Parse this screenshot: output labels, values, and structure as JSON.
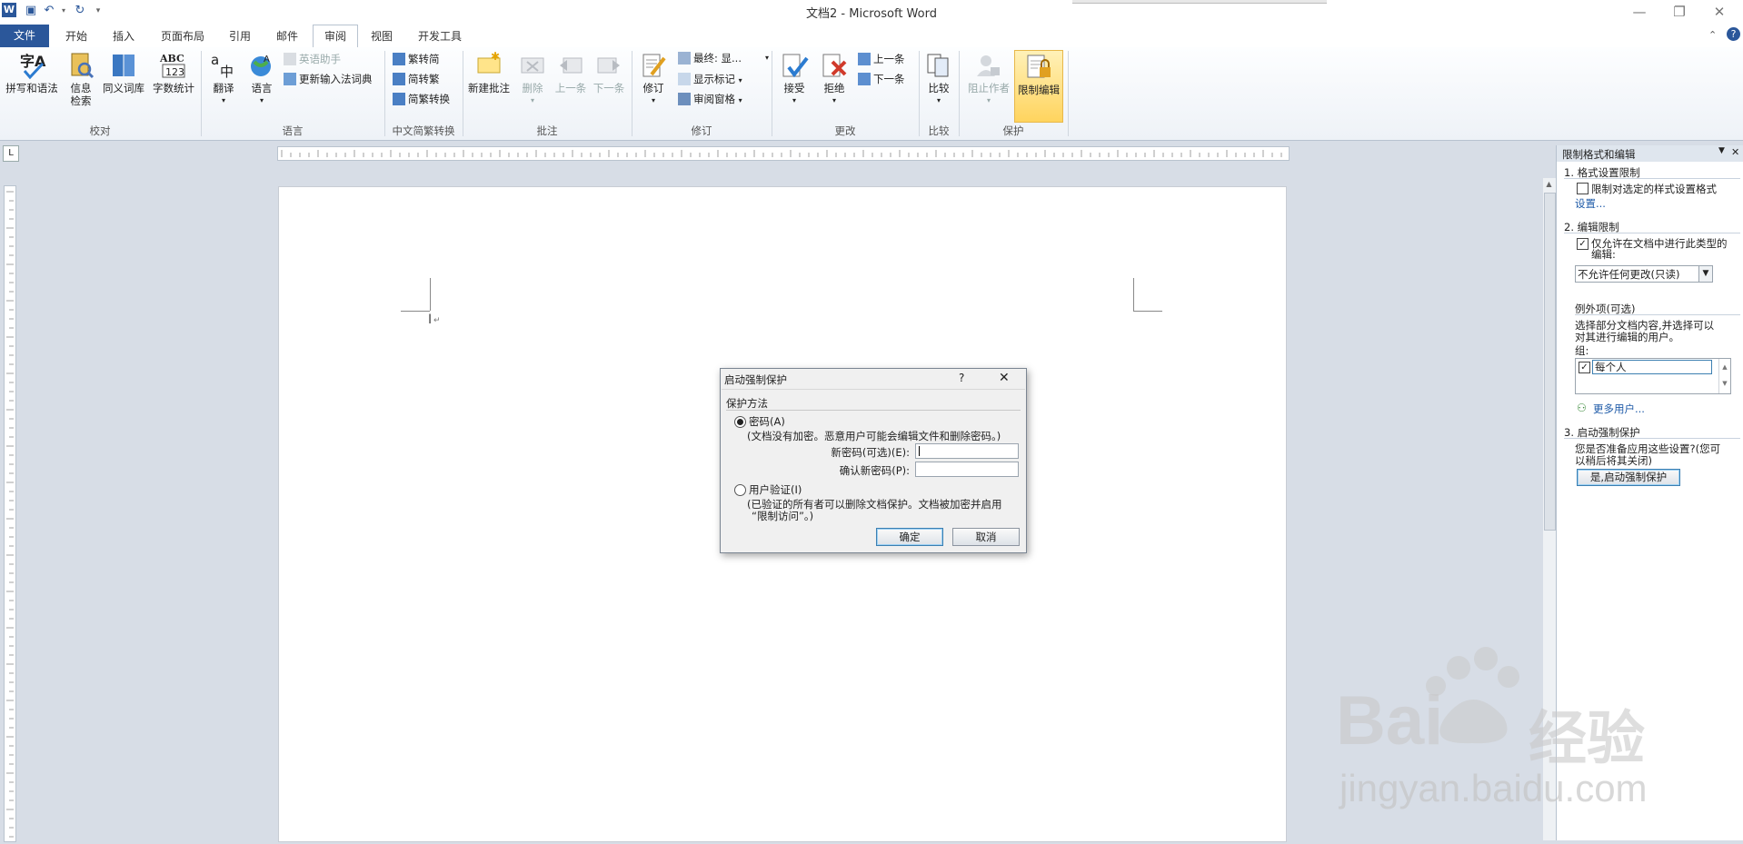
{
  "window": {
    "title": "文档2 - Microsoft Word"
  },
  "tabs": [
    {
      "label": "文件"
    },
    {
      "label": "开始"
    },
    {
      "label": "插入"
    },
    {
      "label": "页面布局"
    },
    {
      "label": "引用"
    },
    {
      "label": "邮件"
    },
    {
      "label": "审阅"
    },
    {
      "label": "视图"
    },
    {
      "label": "开发工具"
    }
  ],
  "ribbon": {
    "proofing": {
      "spell": "拼写和语法",
      "research1": "信息",
      "research2": "检索",
      "thesaurus": "同义词库",
      "wordcount": "字数统计",
      "group": "校对"
    },
    "language": {
      "translate": "翻译",
      "language": "语言",
      "english_assist": "英语助手",
      "update_ime": "更新输入法词典",
      "group": "语言"
    },
    "chinese": {
      "to_simplified": "繁转简",
      "to_traditional": "简转繁",
      "convert": "简繁转换",
      "group": "中文简繁转换"
    },
    "comments": {
      "new": "新建批注",
      "delete": "删除",
      "prev": "上一条",
      "next": "下一条",
      "group": "批注"
    },
    "tracking": {
      "track": "修订",
      "display": "最终: 显...",
      "show_markup": "显示标记",
      "pane": "审阅窗格",
      "group": "修订"
    },
    "changes": {
      "accept": "接受",
      "reject": "拒绝",
      "prev": "上一条",
      "next": "下一条",
      "group": "更改"
    },
    "compare": {
      "compare": "比较",
      "group": "比较"
    },
    "protect": {
      "block": "阻止作者",
      "restrict": "限制编辑",
      "group": "保护"
    }
  },
  "dialog": {
    "title": "启动强制保护",
    "help": "?",
    "close": "✕",
    "section": "保护方法",
    "password_option": "密码(A)",
    "password_note": "(文档没有加密。恶意用户可能会编辑文件和删除密码。)",
    "new_password_label": "新密码(可选)(E):",
    "confirm_password_label": "确认新密码(P):",
    "user_auth_option": "用户验证(I)",
    "user_auth_note1": "(已验证的所有者可以删除文档保护。文档被加密并启用",
    "user_auth_note2": "“限制访问”。)",
    "ok": "确定",
    "cancel": "取消"
  },
  "pane": {
    "title": "限制格式和编辑",
    "s1_title": "1. 格式设置限制",
    "s1_check": "限制对选定的样式设置格式",
    "s1_link": "设置...",
    "s2_title": "2. 编辑限制",
    "s2_check1": "仅允许在文档中进行此类型的",
    "s2_check2": "编辑:",
    "s2_select": "不允许任何更改(只读)",
    "exceptions_title": "例外项(可选)",
    "exceptions_desc1": "选择部分文档内容,并选择可以",
    "exceptions_desc2": "对其进行编辑的用户。",
    "group_label": "组:",
    "group_item": "每个人",
    "more_users": "更多用户...",
    "s3_title": "3. 启动强制保护",
    "s3_desc1": "您是否准备应用这些设置?(您可",
    "s3_desc2": "以稍后将其关闭)",
    "s3_button": "是,启动强制保护"
  },
  "watermark": {
    "brand": "Bai",
    "brand2": "经验",
    "url": "jingyan.baidu.com"
  },
  "colors": {
    "accent": "#2b579a",
    "highlight": "#ffd45e"
  }
}
